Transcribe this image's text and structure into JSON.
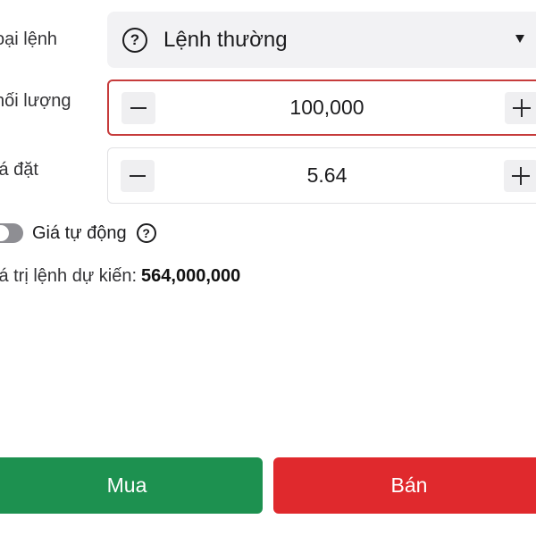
{
  "order_type": {
    "label": "oại lệnh",
    "value": "Lệnh thường",
    "help_icon": "question-circle-icon",
    "dropdown_icon": "caret-down-icon"
  },
  "quantity": {
    "label": "hối lượng",
    "value": "100,000",
    "minus_icon": "minus-icon",
    "plus_icon": "plus-icon",
    "active_border_color": "#c63b3b"
  },
  "price": {
    "label": "iá đặt",
    "value": "5.64",
    "minus_icon": "minus-icon",
    "plus_icon": "plus-icon"
  },
  "auto_price": {
    "label": "Giá tự động",
    "toggle_on": false,
    "help_icon": "question-circle-icon",
    "help_glyph": "?"
  },
  "estimate": {
    "label": "iá trị lệnh dự kiến:",
    "value": "564,000,000"
  },
  "actions": {
    "buy_label": "Mua",
    "sell_label": "Bán",
    "buy_color": "#1d9150",
    "sell_color": "#e0292d"
  }
}
